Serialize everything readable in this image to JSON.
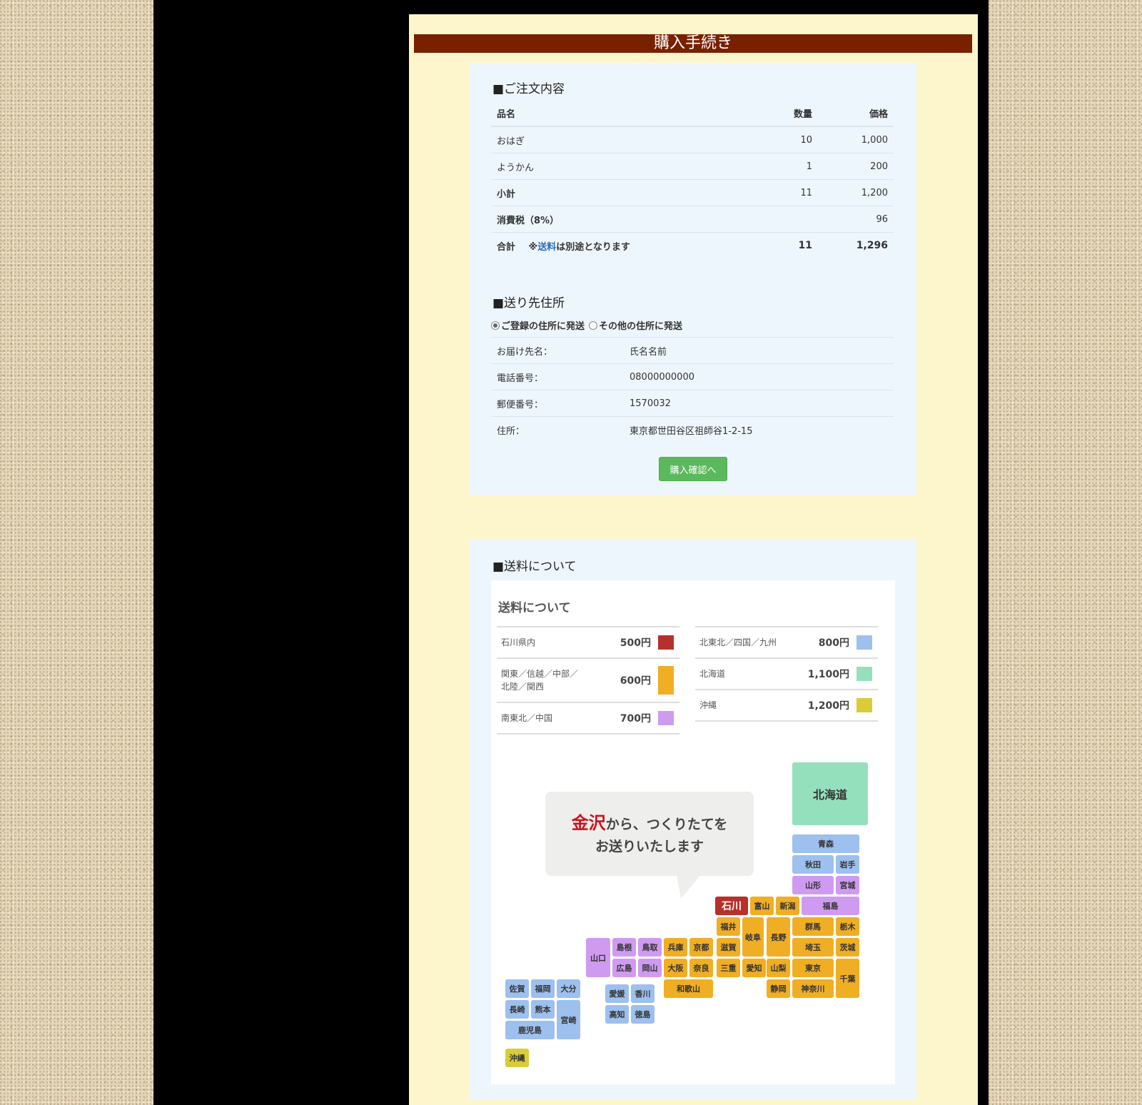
{
  "page_title": "購入手続き",
  "order": {
    "section_title": "■ご注文内容",
    "headers": {
      "name": "品名",
      "qty": "数量",
      "price": "価格"
    },
    "items": [
      {
        "name": "おはぎ",
        "qty": "10",
        "price": "1,000"
      },
      {
        "name": "ようかん",
        "qty": "1",
        "price": "200"
      }
    ],
    "subtotal": {
      "label": "小計",
      "qty": "11",
      "price": "1,200"
    },
    "tax": {
      "label": "消費税（8%）",
      "price": "96"
    },
    "total": {
      "label": "合計",
      "note_prefix": "※",
      "note_link": "送料",
      "note_suffix": "は別途となります",
      "qty": "11",
      "price": "1,296"
    }
  },
  "address": {
    "section_title": "■送り先住所",
    "option_registered": "ご登録の住所に発送",
    "option_other": "その他の住所に発送",
    "rows": [
      {
        "label": "お届け先名：",
        "value": "氏名名前"
      },
      {
        "label": "電話番号：",
        "value": "08000000000"
      },
      {
        "label": "郵便番号：",
        "value": "1570032"
      },
      {
        "label": "住所：",
        "value": "東京都世田谷区祖師谷1-2-15"
      }
    ],
    "confirm_button": "購入確認へ"
  },
  "shipping": {
    "section_title": "■送料について",
    "card_title": "送料について",
    "rates_left": [
      {
        "name": "石川県内",
        "price": "500円",
        "color": "#b8302a"
      },
      {
        "name": "関東／信越／中部／\n北陸／関西",
        "price": "600円",
        "color": "#f0ae25"
      },
      {
        "name": "南東北／中国",
        "price": "700円",
        "color": "#cf9bf0"
      }
    ],
    "rates_right": [
      {
        "name": "北東北／四国／九州",
        "price": "800円",
        "color": "#9dc0ee"
      },
      {
        "name": "北海道",
        "price": "1,100円",
        "color": "#94e0bd"
      },
      {
        "name": "沖縄",
        "price": "1,200円",
        "color": "#d9cc36"
      }
    ],
    "slogan_highlight": "金沢",
    "slogan_line1_rest": "から、つくりたてを",
    "slogan_line2": "お送りいたします",
    "prefectures": [
      "北海道",
      "青森",
      "秋田",
      "岩手",
      "山形",
      "宮城",
      "石川",
      "富山",
      "新潟",
      "福島",
      "福井",
      "岐阜",
      "長野",
      "群馬",
      "栃木",
      "島根",
      "鳥取",
      "兵庫",
      "京都",
      "滋賀",
      "埼玉",
      "茨城",
      "山口",
      "広島",
      "岡山",
      "大阪",
      "奈良",
      "三重",
      "愛知",
      "山梨",
      "東京",
      "千葉",
      "佐賀",
      "福岡",
      "大分",
      "静岡",
      "神奈川",
      "愛媛",
      "香川",
      "和歌山",
      "長崎",
      "熊本",
      "宮崎",
      "高知",
      "徳島",
      "鹿児島",
      "沖縄"
    ]
  }
}
